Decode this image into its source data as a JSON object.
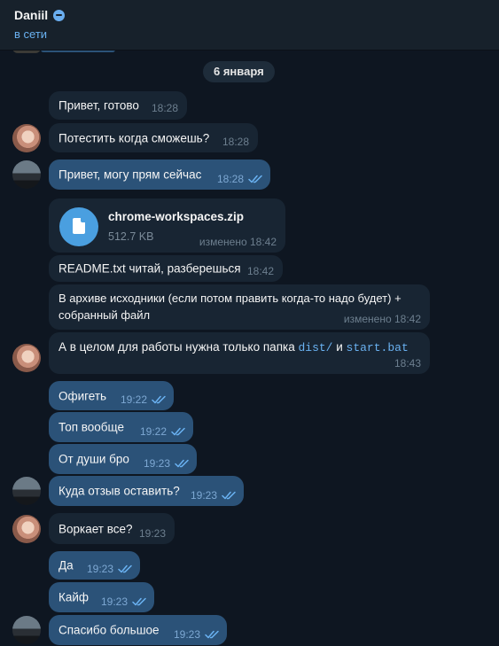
{
  "header": {
    "name": "Daniil",
    "status": "в сети"
  },
  "date_divider": "6 января",
  "file": {
    "name": "chrome-workspaces.zip",
    "size": "512.7 KB",
    "time": "изменено 18:42"
  },
  "messages": [
    {
      "text": "Привет, готово",
      "time": "18:28"
    },
    {
      "text": "Потестить когда сможешь?",
      "time": "18:28"
    },
    {
      "text": "Привет, могу прям сейчас",
      "time": "18:28"
    },
    {
      "text": "README.txt читай, разберешься",
      "time": "18:42"
    },
    {
      "line1": "В архиве исходники (если потом править когда-то надо будет) +",
      "line2": "собранный файл",
      "time": "изменено 18:42"
    },
    {
      "pre": "А в целом для работы нужна только папка ",
      "code1": "dist/",
      "mid": " и ",
      "code2": "start.bat",
      "time": "18:43"
    },
    {
      "text": "Офигеть",
      "time": "19:22"
    },
    {
      "text": "Топ вообще",
      "time": "19:22"
    },
    {
      "text": "От души бро",
      "time": "19:23"
    },
    {
      "text": "Куда отзыв оставить?",
      "time": "19:23"
    },
    {
      "text": "Воркает все?",
      "time": "19:23"
    },
    {
      "text": "Да",
      "time": "19:23"
    },
    {
      "text": "Кайф",
      "time": "19:23"
    },
    {
      "text": "Спасибо большое",
      "time": "19:23"
    }
  ]
}
